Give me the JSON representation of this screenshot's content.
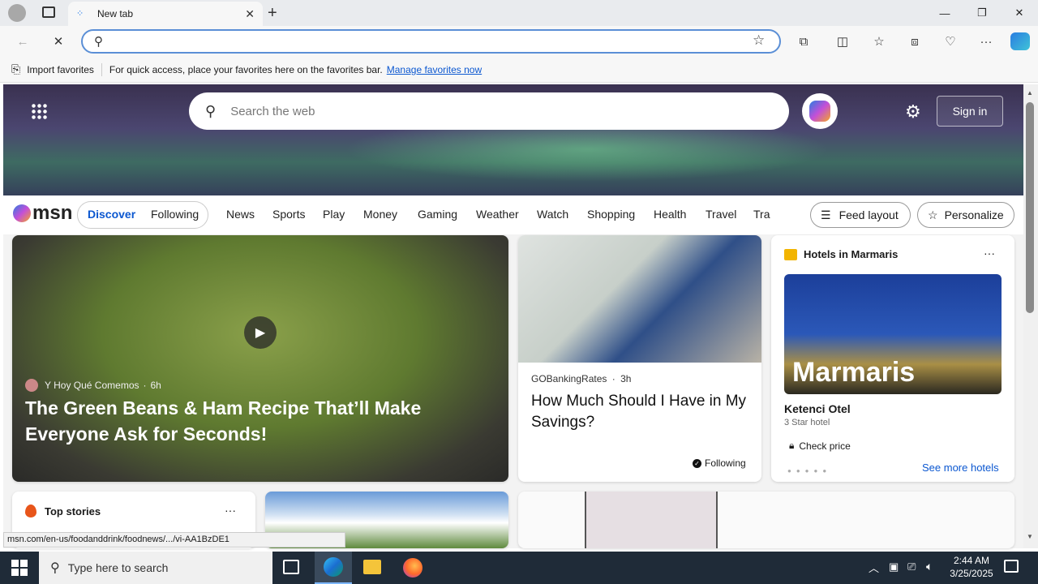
{
  "browser": {
    "tab_title": "New tab",
    "address_value": "",
    "favbar": {
      "import_label": "Import favorites",
      "hint": "For quick access, place your favorites here on the favorites bar.",
      "manage_link": "Manage favorites now"
    },
    "status_url": "msn.com/en-us/foodanddrink/foodnews/.../vi-AA1BzDE1"
  },
  "msn": {
    "search_placeholder": "Search the web",
    "signin_label": "Sign in",
    "logo_text": "msn",
    "toggle": [
      "Discover",
      "Following"
    ],
    "nav": [
      "News",
      "Sports",
      "Play",
      "Money",
      "Gaming",
      "Weather",
      "Watch",
      "Shopping",
      "Health",
      "Travel",
      "Tra"
    ],
    "feed_layout_label": "Feed layout",
    "personalize_label": "Personalize"
  },
  "cards": {
    "main": {
      "source": "Y Hoy Qué Comemos",
      "age": "6h",
      "title": "The Green Beans & Ham Recipe That’ll Make Everyone Ask for Seconds!"
    },
    "savings": {
      "source": "GOBankingRates",
      "age": "3h",
      "title": "How Much Should I Have in My Savings?",
      "following": "Following"
    },
    "hotels": {
      "header": "Hotels in Marmaris",
      "banner_text": "Marmaris",
      "hotel_name": "Ketenci Otel",
      "hotel_type": "3 Star hotel",
      "check_price": "Check price",
      "see_more": "See more hotels"
    },
    "topstories": {
      "title": "Top stories"
    }
  },
  "taskbar": {
    "search_placeholder": "Type here to search",
    "time": "2:44 AM",
    "date": "3/25/2025"
  }
}
